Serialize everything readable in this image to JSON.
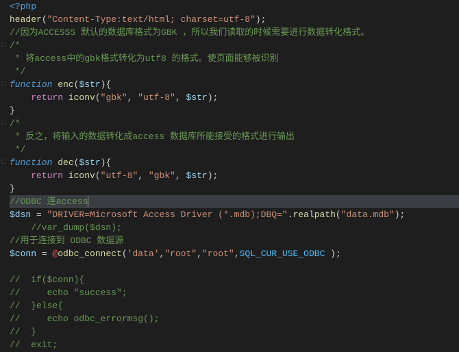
{
  "lines": [
    {
      "indent": 0,
      "fold": "",
      "segs": [
        {
          "c": "tag",
          "t": "<?php"
        }
      ]
    },
    {
      "indent": 1,
      "fold": "",
      "segs": [
        {
          "c": "fn",
          "t": "header"
        },
        {
          "c": "pn",
          "t": "("
        },
        {
          "c": "str",
          "t": "\"Content-Type:text/html; charset=utf-8\""
        },
        {
          "c": "pn",
          "t": ");"
        }
      ]
    },
    {
      "indent": 1,
      "fold": "",
      "segs": [
        {
          "c": "cm",
          "t": "//因为ACCESSS 默认的数据库格式为GBK ，所以我们读取的时候需要进行数据转化格式。"
        }
      ]
    },
    {
      "indent": 1,
      "fold": "□",
      "segs": [
        {
          "c": "cm",
          "t": "/*"
        }
      ]
    },
    {
      "indent": 1,
      "fold": "",
      "segs": [
        {
          "c": "cm",
          "t": " * 将access中的gbk格式转化为utf8 的格式。使页面能够被识别"
        }
      ]
    },
    {
      "indent": 1,
      "fold": "",
      "segs": [
        {
          "c": "cm",
          "t": " */"
        }
      ]
    },
    {
      "indent": 1,
      "fold": "□",
      "segs": [
        {
          "c": "kw",
          "t": "function"
        },
        {
          "c": "op",
          "t": " "
        },
        {
          "c": "fn",
          "t": "enc"
        },
        {
          "c": "pn",
          "t": "("
        },
        {
          "c": "var",
          "t": "$str"
        },
        {
          "c": "pn",
          "t": "){"
        }
      ]
    },
    {
      "indent": 2,
      "fold": "",
      "segs": [
        {
          "c": "kw2",
          "t": "    return"
        },
        {
          "c": "op",
          "t": " "
        },
        {
          "c": "fn",
          "t": "iconv"
        },
        {
          "c": "pn",
          "t": "("
        },
        {
          "c": "str",
          "t": "\"gbk\""
        },
        {
          "c": "pn",
          "t": ", "
        },
        {
          "c": "str",
          "t": "\"utf-8\""
        },
        {
          "c": "pn",
          "t": ", "
        },
        {
          "c": "var",
          "t": "$str"
        },
        {
          "c": "pn",
          "t": ");"
        }
      ]
    },
    {
      "indent": 1,
      "fold": "",
      "segs": [
        {
          "c": "pn",
          "t": "}"
        }
      ]
    },
    {
      "indent": 1,
      "fold": "□",
      "segs": [
        {
          "c": "cm",
          "t": "/*"
        }
      ]
    },
    {
      "indent": 1,
      "fold": "",
      "segs": [
        {
          "c": "cm",
          "t": " * 反之，将输入的数据转化成access 数据库所能接受的格式进行输出"
        }
      ]
    },
    {
      "indent": 1,
      "fold": "",
      "segs": [
        {
          "c": "cm",
          "t": " */"
        }
      ]
    },
    {
      "indent": 1,
      "fold": "□",
      "segs": [
        {
          "c": "kw",
          "t": "function"
        },
        {
          "c": "op",
          "t": " "
        },
        {
          "c": "fn",
          "t": "dec"
        },
        {
          "c": "pn",
          "t": "("
        },
        {
          "c": "var",
          "t": "$str"
        },
        {
          "c": "pn",
          "t": "){"
        }
      ]
    },
    {
      "indent": 2,
      "fold": "",
      "segs": [
        {
          "c": "kw2",
          "t": "    return"
        },
        {
          "c": "op",
          "t": " "
        },
        {
          "c": "fn",
          "t": "iconv"
        },
        {
          "c": "pn",
          "t": "("
        },
        {
          "c": "str",
          "t": "\"utf-8\""
        },
        {
          "c": "pn",
          "t": ", "
        },
        {
          "c": "str",
          "t": "\"gbk\""
        },
        {
          "c": "pn",
          "t": ", "
        },
        {
          "c": "var",
          "t": "$str"
        },
        {
          "c": "pn",
          "t": ");"
        }
      ]
    },
    {
      "indent": 1,
      "fold": "",
      "segs": [
        {
          "c": "pn",
          "t": "}"
        }
      ]
    },
    {
      "indent": 1,
      "fold": "",
      "hl": true,
      "segs": [
        {
          "c": "cm",
          "t": "//ODBC 连access"
        }
      ],
      "cursor": true
    },
    {
      "indent": 1,
      "fold": "",
      "segs": [
        {
          "c": "var",
          "t": "$dsn"
        },
        {
          "c": "op",
          "t": " = "
        },
        {
          "c": "str",
          "t": "\"DRIVER=Microsoft Access Driver (*.mdb);DBQ=\""
        },
        {
          "c": "op",
          "t": "."
        },
        {
          "c": "fn",
          "t": "realpath"
        },
        {
          "c": "pn",
          "t": "("
        },
        {
          "c": "str",
          "t": "\"data.mdb\""
        },
        {
          "c": "pn",
          "t": ");"
        }
      ]
    },
    {
      "indent": 2,
      "fold": "",
      "segs": [
        {
          "c": "cm",
          "t": "    //var_dump($dsn);"
        }
      ]
    },
    {
      "indent": 1,
      "fold": "",
      "segs": [
        {
          "c": "cm",
          "t": "//用于连接到 ODBC 数据源"
        }
      ]
    },
    {
      "indent": 1,
      "fold": "",
      "segs": [
        {
          "c": "var",
          "t": "$conn"
        },
        {
          "c": "op",
          "t": " = "
        },
        {
          "c": "err",
          "t": "@"
        },
        {
          "c": "fn",
          "t": "odbc_connect"
        },
        {
          "c": "pn",
          "t": "("
        },
        {
          "c": "str",
          "t": "'data'"
        },
        {
          "c": "pn",
          "t": ","
        },
        {
          "c": "str",
          "t": "\"root\""
        },
        {
          "c": "pn",
          "t": ","
        },
        {
          "c": "str",
          "t": "\"root\""
        },
        {
          "c": "pn",
          "t": ","
        },
        {
          "c": "const",
          "t": "SQL_CUR_USE_ODBC"
        },
        {
          "c": "pn",
          "t": " );"
        }
      ]
    },
    {
      "indent": 0,
      "fold": "",
      "segs": [
        {
          "c": "op",
          "t": ""
        }
      ]
    },
    {
      "indent": 1,
      "fold": "",
      "segs": [
        {
          "c": "cm",
          "t": "//  if($conn){"
        }
      ]
    },
    {
      "indent": 1,
      "fold": "",
      "segs": [
        {
          "c": "cm",
          "t": "//     echo \"success\";"
        }
      ]
    },
    {
      "indent": 1,
      "fold": "",
      "segs": [
        {
          "c": "cm",
          "t": "//  }else{"
        }
      ]
    },
    {
      "indent": 1,
      "fold": "",
      "segs": [
        {
          "c": "cm",
          "t": "//     echo odbc_errormsg();"
        }
      ]
    },
    {
      "indent": 1,
      "fold": "",
      "segs": [
        {
          "c": "cm",
          "t": "//  }"
        }
      ]
    },
    {
      "indent": 1,
      "fold": "",
      "segs": [
        {
          "c": "cm",
          "t": "//  exit;"
        }
      ]
    }
  ]
}
